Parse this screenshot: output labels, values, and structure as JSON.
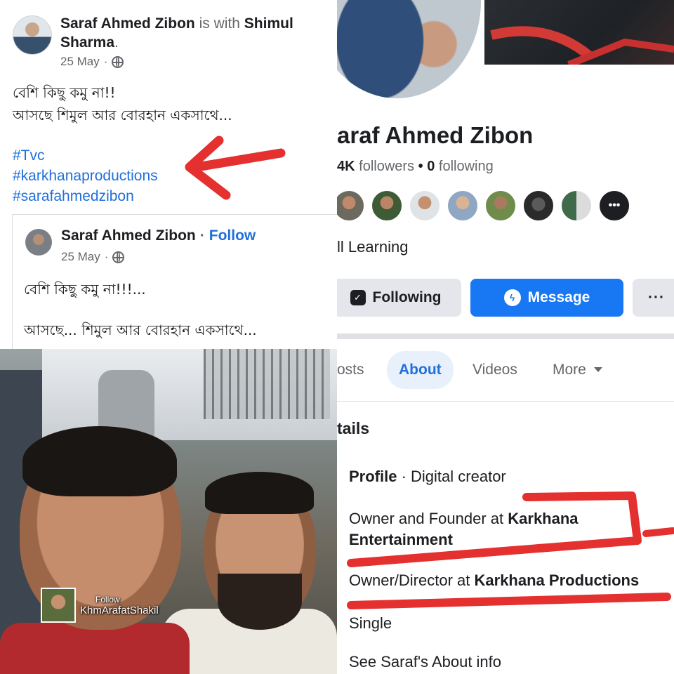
{
  "post": {
    "author": "Saraf Ahmed Zibon",
    "with_text": "is with",
    "tagged_first": "Shimul",
    "tagged_second": "Sharma",
    "period": ".",
    "date": "25 May",
    "date_sep": "·",
    "text_line1": "বেশি কিছু কমু না!!",
    "text_line2": "আসছে শিমুল আর বোরহান একসাথে...",
    "hashtags": [
      "#Tvc",
      "#karkhanaproductions",
      "#sarafahmedzibon"
    ],
    "annotation_color": "#e4312f"
  },
  "shared_post": {
    "author": "Saraf Ahmed Zibon",
    "separator": "·",
    "follow_label": "Follow",
    "date": "25 May",
    "date_sep": "·",
    "text_line1": "বেশি কিছু কমু না!!!...",
    "text_line2": "আসছে... শিমুল আর বোরহান একসাথে..."
  },
  "profile": {
    "name": "araf Ahmed Zibon",
    "followers_count": "4K",
    "followers_label": "followers",
    "dot": "•",
    "following_count": "0",
    "following_label": "following",
    "friends_more_label": "•••",
    "intro": "ll Learning",
    "buttons": {
      "following": "Following",
      "message": "Message",
      "more": "···"
    },
    "tabs": [
      "osts",
      "About",
      "Videos",
      "More"
    ],
    "active_tab": "About",
    "details_heading": "tails",
    "details": {
      "profile_label": "Profile",
      "profile_value": "· Digital creator",
      "job1_prefix": "Owner and Founder at",
      "job1_org": "Karkhana Entertainment",
      "job2_prefix": "Owner/Director at",
      "job2_org": "Karkhana Productions",
      "relationship": "Single",
      "see_about": "See Saraf's About info"
    },
    "colors": {
      "primary": "#1877f2",
      "link": "#216fdb",
      "annotation": "#e4312f"
    }
  },
  "photo": {
    "watermark_follow": "Follow",
    "watermark_name": "KhmArafatShakil"
  }
}
